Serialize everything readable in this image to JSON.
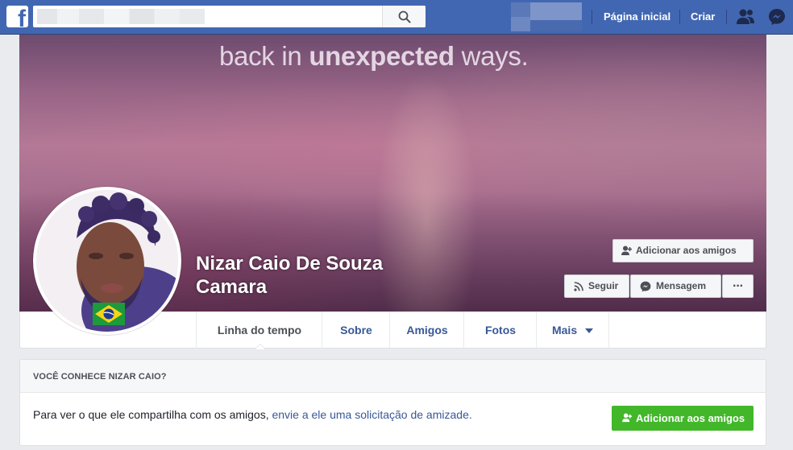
{
  "topbar": {
    "logo_letter": "f",
    "search_placeholder": "",
    "nav": {
      "home": "Página inicial",
      "create": "Criar"
    },
    "icons": [
      "search-icon",
      "friend-requests-icon",
      "messenger-icon"
    ]
  },
  "cover": {
    "text_plain": "back in ",
    "text_bold": "unexpected",
    "text_end": " ways."
  },
  "profile": {
    "name": "Nizar Caio De Souza Camara",
    "add_friend_label": "Adicionar aos amigos",
    "follow_label": "Seguir",
    "message_label": "Mensagem",
    "more_label": "···"
  },
  "tabs": [
    {
      "label": "Linha do tempo"
    },
    {
      "label": "Sobre"
    },
    {
      "label": "Amigos"
    },
    {
      "label": "Fotos"
    },
    {
      "label": "Mais"
    }
  ],
  "suggestion_card": {
    "title": "VOCÊ CONHECE NIZAR CAIO?",
    "text_plain": "Para ver o que ele compartilha com os amigos, ",
    "text_link": "envie a ele uma solicitação de amizade.",
    "button_label": "Adicionar aos amigos"
  },
  "colors": {
    "brand": "#4267b2",
    "link": "#385898",
    "green": "#42b72a"
  }
}
